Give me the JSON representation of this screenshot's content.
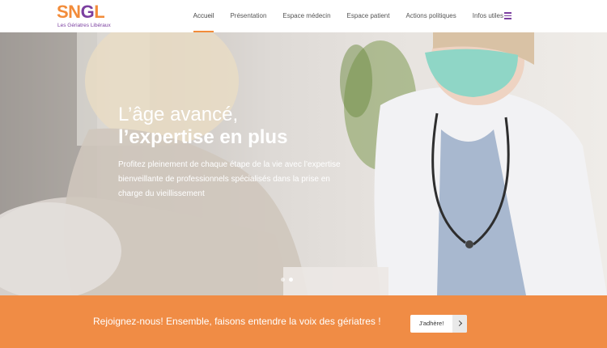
{
  "header": {
    "logo_text": "SNGL",
    "logo_subtitle": "Les Gériatres Libéraux",
    "nav": [
      {
        "label": "Accueil",
        "active": true
      },
      {
        "label": "Présentation",
        "active": false
      },
      {
        "label": "Espace médecin",
        "active": false
      },
      {
        "label": "Espace patient",
        "active": false
      },
      {
        "label": "Actions politiques",
        "active": false
      },
      {
        "label": "Infos utiles",
        "active": false
      }
    ],
    "menu_icon": "hamburger-menu-icon"
  },
  "hero": {
    "title_line1": "L’âge avancé,",
    "title_line2": "l’expertise en plus",
    "text": "Profitez pleinement de chaque étape de la vie avec l’expertise bienveillante de professionnels spécialisés dans la prise en charge du vieillissement",
    "slides_count": 2,
    "active_slide": 2
  },
  "band": {
    "text": "Rejoignez-nous! Ensemble, faisons entendre la voix des gériatres !",
    "button_label": "J'adhère!",
    "button_icon": "chevron-right-icon"
  },
  "colors": {
    "accent_orange": "#f08c45",
    "brand_purple": "#7b3fa0"
  }
}
